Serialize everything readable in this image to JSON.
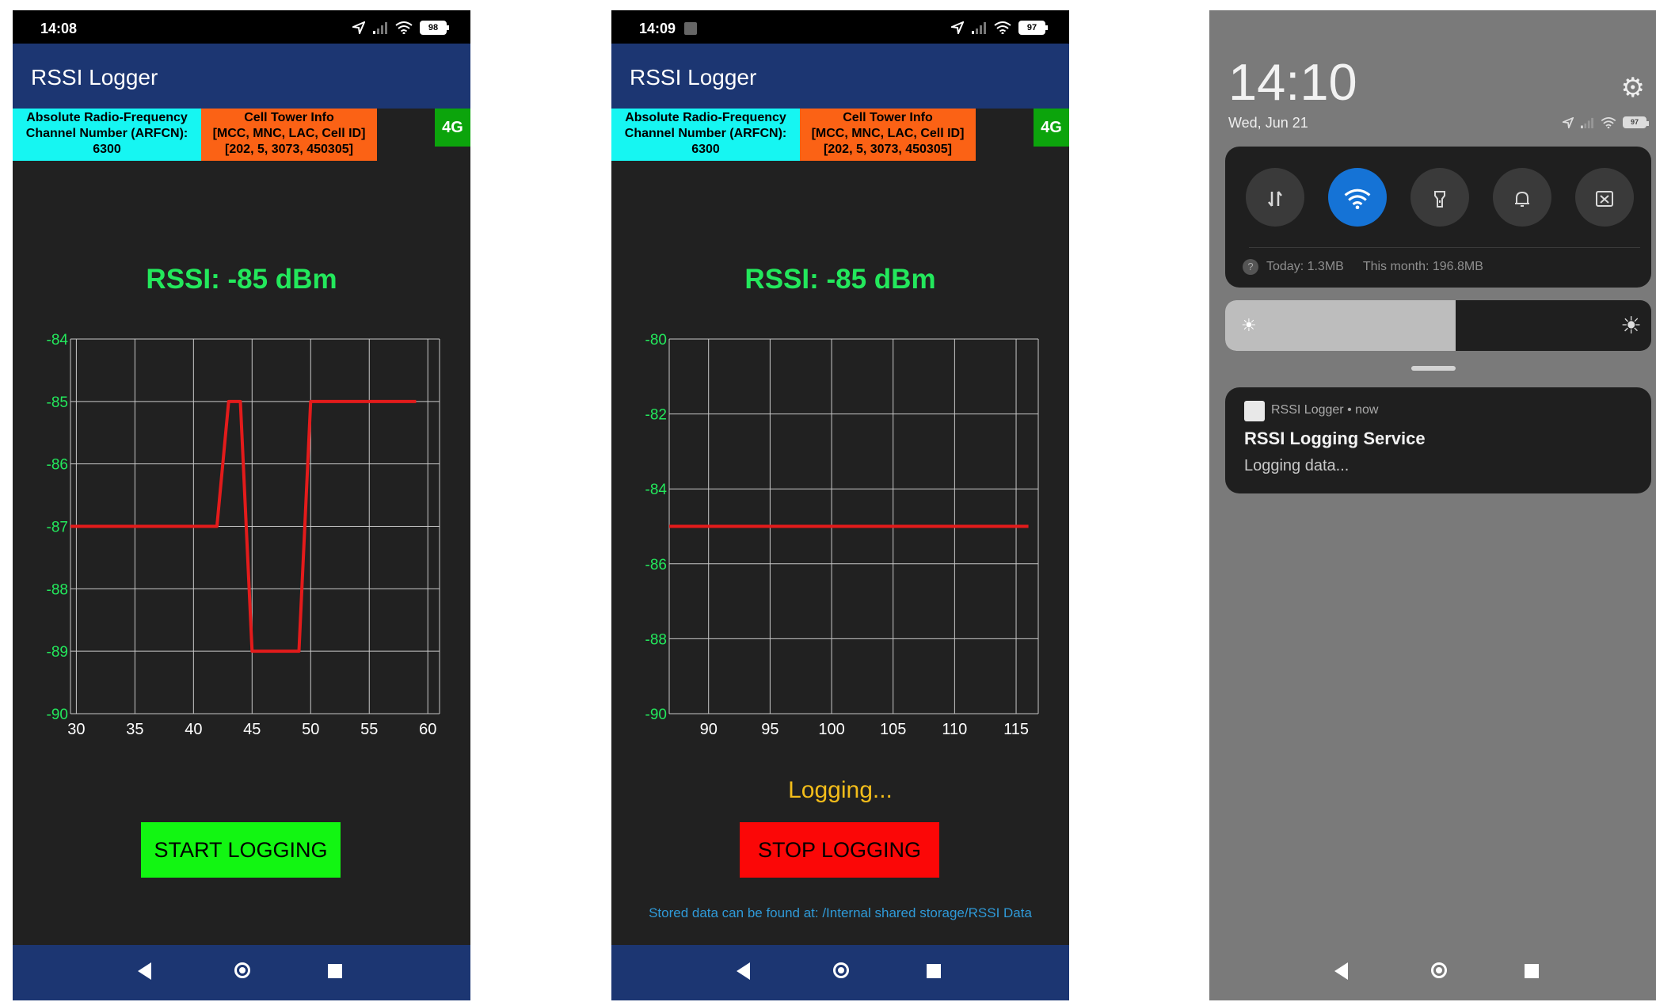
{
  "phones": [
    {
      "time": "14:08",
      "battery": "98",
      "app_title": "RSSI Logger",
      "arfcn": {
        "label1": "Absolute Radio-Frequency",
        "label2": "Channel Number (ARFCN):",
        "value": "6300"
      },
      "cell": {
        "label1": "Cell Tower Info",
        "label2": "[MCC, MNC, LAC, Cell ID]",
        "value": "[202, 5, 3073, 450305]"
      },
      "network": "4G",
      "rssi_text": "RSSI: -85 dBm",
      "button_label": "START LOGGING"
    },
    {
      "time": "14:09",
      "battery": "97",
      "app_title": "RSSI Logger",
      "arfcn": {
        "label1": "Absolute Radio-Frequency",
        "label2": "Channel Number (ARFCN):",
        "value": "6300"
      },
      "cell": {
        "label1": "Cell Tower Info",
        "label2": "[MCC, MNC, LAC, Cell ID]",
        "value": "[202, 5, 3073, 450305]"
      },
      "network": "4G",
      "rssi_text": "RSSI: -85 dBm",
      "status_text": "Logging...",
      "button_label": "STOP LOGGING",
      "stored_text": "Stored data can be found at: /Internal shared storage/RSSI Data"
    }
  ],
  "shade": {
    "time": "14:10",
    "date": "Wed, Jun 21",
    "battery": "97",
    "data_today": "Today: 1.3MB",
    "data_month": "This month: 196.8MB",
    "brightness_fraction": 0.54,
    "quick_toggles": [
      {
        "icon": "data-transfer-icon",
        "on": false
      },
      {
        "icon": "wifi-icon",
        "on": true
      },
      {
        "icon": "flashlight-icon",
        "on": false
      },
      {
        "icon": "bell-icon",
        "on": false
      },
      {
        "icon": "screenshot-icon",
        "on": false
      }
    ],
    "notification": {
      "app": "RSSI Logger",
      "age": "now",
      "title": "RSSI Logging Service",
      "body": "Logging data..."
    }
  },
  "colors": {
    "appbar": "#1c3672",
    "rssi_green": "#23e85c",
    "plot_line": "#e31b1b",
    "start_button": "#12f612",
    "stop_button": "#fb0707",
    "logging_text": "#f3bd1a",
    "quick_toggle_on": "#1573d6"
  },
  "chart_data": [
    {
      "type": "line",
      "title": "",
      "xlabel": "",
      "ylabel": "",
      "xlim": [
        29.5,
        61
      ],
      "ylim": [
        -90,
        -84
      ],
      "x_ticks": [
        30,
        35,
        40,
        45,
        50,
        55,
        60
      ],
      "y_ticks": [
        -84,
        -85,
        -86,
        -87,
        -88,
        -89,
        -90
      ],
      "grid": true,
      "series": [
        {
          "x": [
            29.5,
            30,
            35,
            40,
            42,
            43,
            44,
            45,
            46,
            47,
            48,
            49,
            50,
            55,
            59
          ],
          "y": [
            -87,
            -87,
            -87,
            -87,
            -87,
            -85,
            -85,
            -89,
            -89,
            -89,
            -89,
            -89,
            -85,
            -85,
            -85
          ]
        }
      ]
    },
    {
      "type": "line",
      "title": "",
      "xlabel": "",
      "ylabel": "",
      "xlim": [
        86.8,
        116.8
      ],
      "ylim": [
        -90,
        -80
      ],
      "x_ticks": [
        90,
        95,
        100,
        105,
        110,
        115
      ],
      "y_ticks": [
        -80,
        -82,
        -84,
        -86,
        -88,
        -90
      ],
      "grid": true,
      "series": [
        {
          "x": [
            86.8,
            90,
            95,
            100,
            105,
            110,
            115,
            116
          ],
          "y": [
            -85,
            -85,
            -85,
            -85,
            -85,
            -85,
            -85,
            -85
          ]
        }
      ]
    }
  ]
}
